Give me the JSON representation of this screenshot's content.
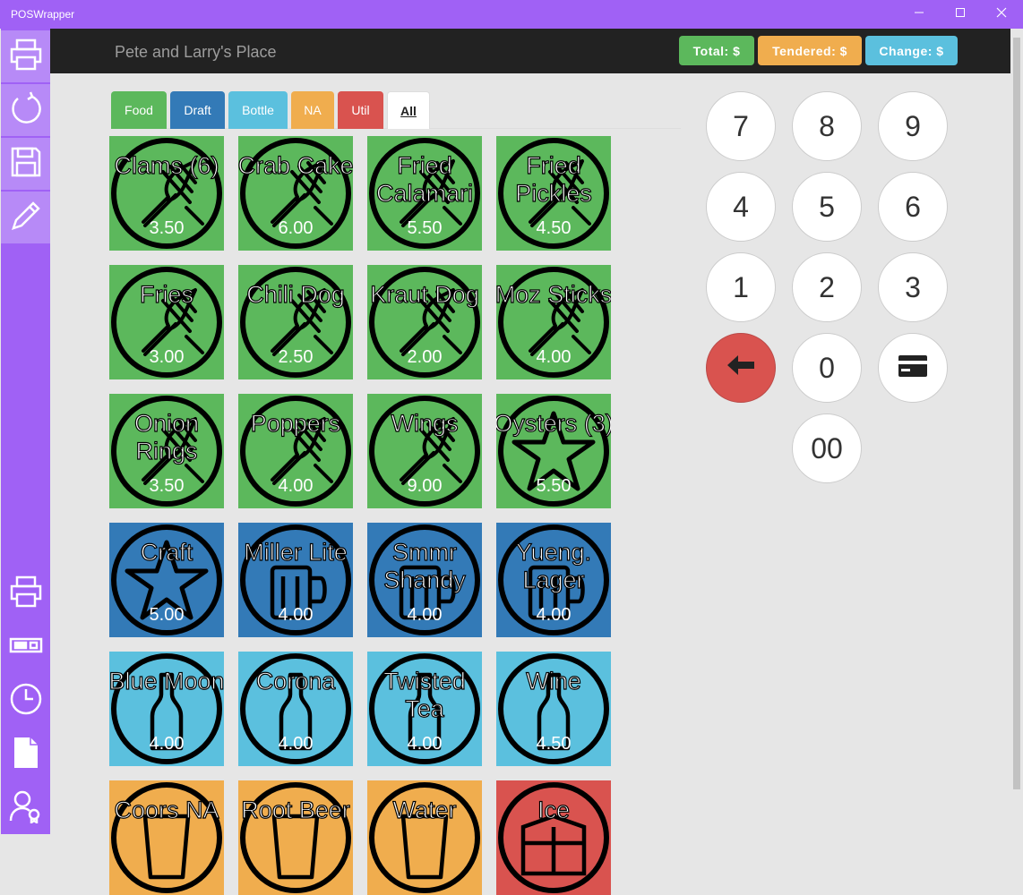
{
  "window": {
    "title": "POSWrapper",
    "minimize_icon": "minimize-icon",
    "maximize_icon": "maximize-icon",
    "close_icon": "close-icon"
  },
  "sidebar": {
    "top": [
      "printer-icon",
      "refresh-icon",
      "save-icon",
      "pencil-icon"
    ],
    "bottom": [
      "printer-icon",
      "cash-drawer-icon",
      "clock-icon",
      "document-icon",
      "user-badge-icon"
    ]
  },
  "header": {
    "venue": "Pete and Larry's Place",
    "total_label": "Total: $",
    "tendered_label": "Tendered: $",
    "change_label": "Change: $",
    "total_color": "#5cb85c",
    "tendered_color": "#f0ad4e",
    "change_color": "#5bc0de"
  },
  "tabs": [
    {
      "label": "Food",
      "color": "#5cb85c"
    },
    {
      "label": "Draft",
      "color": "#337ab7"
    },
    {
      "label": "Bottle",
      "color": "#5bc0de"
    },
    {
      "label": "NA",
      "color": "#f0ad4e"
    },
    {
      "label": "Util",
      "color": "#d9534f"
    },
    {
      "label": "All",
      "color": "#ffffff",
      "active": true
    }
  ],
  "products": [
    {
      "name": "Clams (6)",
      "price": "3.50",
      "icon": "utensils-icon",
      "color": "#5cb85c"
    },
    {
      "name": "Crab Cake",
      "price": "6.00",
      "icon": "utensils-icon",
      "color": "#5cb85c"
    },
    {
      "name": "Fried Calamari",
      "price": "5.50",
      "icon": "utensils-icon",
      "color": "#5cb85c"
    },
    {
      "name": "Fried Pickles",
      "price": "4.50",
      "icon": "utensils-icon",
      "color": "#5cb85c"
    },
    {
      "name": "Fries",
      "price": "3.00",
      "icon": "utensils-icon",
      "color": "#5cb85c"
    },
    {
      "name": "Chili Dog",
      "price": "2.50",
      "icon": "utensils-icon",
      "color": "#5cb85c"
    },
    {
      "name": "Kraut Dog",
      "price": "2.00",
      "icon": "utensils-icon",
      "color": "#5cb85c"
    },
    {
      "name": "Moz Sticks",
      "price": "4.00",
      "icon": "utensils-icon",
      "color": "#5cb85c"
    },
    {
      "name": "Onion Rings",
      "price": "3.50",
      "icon": "utensils-icon",
      "color": "#5cb85c"
    },
    {
      "name": "Poppers",
      "price": "4.00",
      "icon": "utensils-icon",
      "color": "#5cb85c"
    },
    {
      "name": "Wings",
      "price": "9.00",
      "icon": "utensils-icon",
      "color": "#5cb85c"
    },
    {
      "name": "Oysters (3)",
      "price": "5.50",
      "icon": "star-icon",
      "color": "#5cb85c"
    },
    {
      "name": "Craft",
      "price": "5.00",
      "icon": "star-icon",
      "color": "#337ab7"
    },
    {
      "name": "Miller Lite",
      "price": "4.00",
      "icon": "mug-icon",
      "color": "#337ab7"
    },
    {
      "name": "Smmr Shandy",
      "price": "4.00",
      "icon": "mug-icon",
      "color": "#337ab7"
    },
    {
      "name": "Yueng. Lager",
      "price": "4.00",
      "icon": "mug-icon",
      "color": "#337ab7"
    },
    {
      "name": "Blue Moon",
      "price": "4.00",
      "icon": "bottle-icon",
      "color": "#5bc0de"
    },
    {
      "name": "Corona",
      "price": "4.00",
      "icon": "bottle-icon",
      "color": "#5bc0de"
    },
    {
      "name": "Twisted Tea",
      "price": "4.00",
      "icon": "bottle-icon",
      "color": "#5bc0de"
    },
    {
      "name": "Wine",
      "price": "4.50",
      "icon": "bottle-icon",
      "color": "#5bc0de"
    },
    {
      "name": "Coors NA",
      "price": "",
      "icon": "glass-icon",
      "color": "#f0ad4e"
    },
    {
      "name": "Root Beer",
      "price": "",
      "icon": "glass-icon",
      "color": "#f0ad4e"
    },
    {
      "name": "Water",
      "price": "",
      "icon": "glass-icon",
      "color": "#f0ad4e"
    },
    {
      "name": "Ice",
      "price": "",
      "icon": "box-icon",
      "color": "#d9534f"
    }
  ],
  "keypad": [
    {
      "label": "7"
    },
    {
      "label": "8"
    },
    {
      "label": "9"
    },
    {
      "label": "4"
    },
    {
      "label": "5"
    },
    {
      "label": "6"
    },
    {
      "label": "1"
    },
    {
      "label": "2"
    },
    {
      "label": "3"
    },
    {
      "label": "",
      "icon": "backspace-arrow-icon",
      "color": "#d9534f"
    },
    {
      "label": "0"
    },
    {
      "label": "",
      "icon": "credit-card-icon"
    },
    {
      "label": "00"
    }
  ]
}
